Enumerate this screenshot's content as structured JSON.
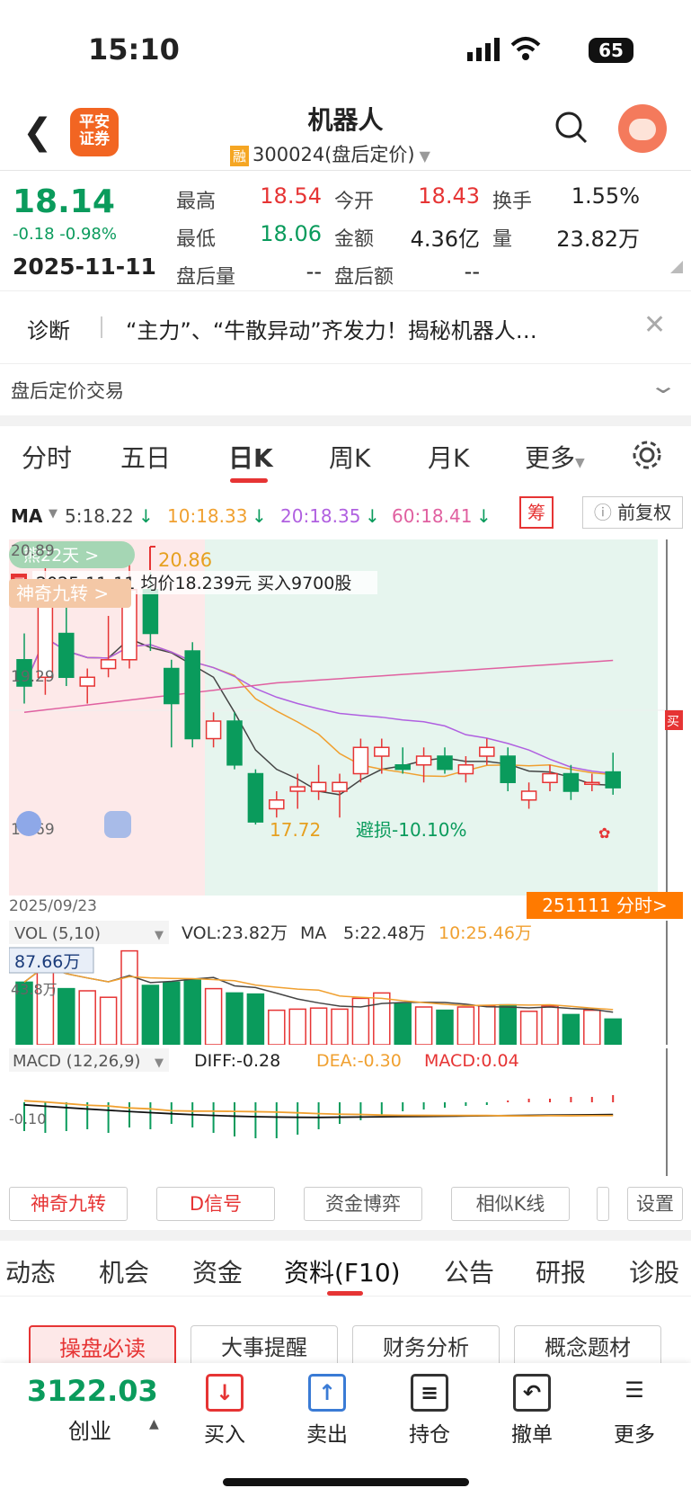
{
  "status": {
    "time": "15:10",
    "battery": "65"
  },
  "header": {
    "title": "机器人",
    "rong": "融",
    "subtitle": "300024(盘后定价)",
    "logo_l1": "平安",
    "logo_l2": "证券"
  },
  "quote": {
    "price": "18.14",
    "change": "-0.18 -0.98%",
    "date": "2025-11-11",
    "items": [
      {
        "label": "最高",
        "value": "18.54",
        "color": "red"
      },
      {
        "label": "今开",
        "value": "18.43",
        "color": "red"
      },
      {
        "label": "换手",
        "value": "1.55%",
        "color": "blk"
      },
      {
        "label": "最低",
        "value": "18.06",
        "color": "green"
      },
      {
        "label": "金额",
        "value": "4.36亿",
        "color": "blk"
      },
      {
        "label": "量",
        "value": "23.82万",
        "color": "blk"
      },
      {
        "label": "盘后量",
        "value": "--",
        "color": "blk"
      },
      {
        "label": "盘后额",
        "value": "--",
        "color": "blk"
      }
    ]
  },
  "diagnosis": {
    "label": "诊断",
    "text": "“主力”、“牛散异动”齐发力！揭秘机器人…"
  },
  "after_hours": {
    "label": "盘后定价交易"
  },
  "chart_tabs": [
    "分时",
    "五日",
    "日K",
    "周K",
    "月K",
    "更多"
  ],
  "ma_legend": {
    "title": "MA",
    "ma5": "5:18.22",
    "ma10": "10:18.33",
    "ma20": "20:18.35",
    "ma60": "60:18.41",
    "colors": {
      "ma5": "#444444",
      "ma10": "#f0a030",
      "ma20": "#b060e0",
      "ma60": "#e060a0"
    }
  },
  "chip_btn": "筹",
  "fq_btn": "前复权",
  "kchart": {
    "bear_label": "熊22天 >",
    "high_label": "20.86",
    "trade_info": "2025-11-11 均价18.239元 买入9700股",
    "shenqi_tag": "神奇九转 >",
    "y_top": "20.89",
    "y_mid": "19.29",
    "y_bot": "17.69",
    "low_label": "17.72",
    "stop_loss": "避损-10.10%",
    "buy_flag": "买",
    "trade_flag": "买"
  },
  "x_start": "2025/09/23",
  "fenshi_btn": "251111 分时>",
  "vol": {
    "title": "VOL (5,10)",
    "vol": "VOL:23.82万",
    "ma": "MA",
    "ma5": "5:22.48万",
    "ma10": "10:25.46万",
    "max_label": "87.66万",
    "mid_label": "43.8万"
  },
  "macd": {
    "title": "MACD (12,26,9)",
    "diff": "DIFF:-0.28",
    "dea": "DEA:-0.30",
    "macd": "MACD:0.04",
    "y_label": "-0.10"
  },
  "tools": [
    "神奇九转",
    "D信号",
    "资金博弈",
    "相似K线",
    "设置"
  ],
  "f_tabs": [
    "动态",
    "机会",
    "资金",
    "资料(F10)",
    "公告",
    "研报",
    "诊股"
  ],
  "sub_btns": [
    "操盘必读",
    "大事提醒",
    "财务分析",
    "概念题材"
  ],
  "bottom": {
    "index_value": "3122.03",
    "index_name": "创业",
    "actions": [
      {
        "label": "买入",
        "icon": "↓"
      },
      {
        "label": "卖出",
        "icon": "↑"
      },
      {
        "label": "持仓",
        "icon": "≡"
      },
      {
        "label": "撤单",
        "icon": "↶"
      },
      {
        "label": "更多",
        "icon": "☰"
      }
    ]
  },
  "chart_data": {
    "type": "candlestick",
    "x_start": "2025/09/23",
    "x_end": "2025-11-11",
    "ylim": [
      17.69,
      20.89
    ],
    "candles": [
      {
        "o": 19.6,
        "c": 19.3,
        "h": 19.9,
        "l": 19.1
      },
      {
        "o": 19.4,
        "c": 20.4,
        "h": 20.8,
        "l": 19.2
      },
      {
        "o": 19.9,
        "c": 19.4,
        "h": 20.2,
        "l": 19.3
      },
      {
        "o": 19.3,
        "c": 19.4,
        "h": 19.5,
        "l": 19.1
      },
      {
        "o": 19.5,
        "c": 19.6,
        "h": 20.1,
        "l": 19.4
      },
      {
        "o": 19.6,
        "c": 20.4,
        "h": 20.86,
        "l": 19.5
      },
      {
        "o": 20.4,
        "c": 19.9,
        "h": 20.6,
        "l": 19.7
      },
      {
        "o": 19.5,
        "c": 19.1,
        "h": 19.6,
        "l": 18.6
      },
      {
        "o": 19.7,
        "c": 18.7,
        "h": 19.8,
        "l": 18.6
      },
      {
        "o": 18.7,
        "c": 18.9,
        "h": 19.0,
        "l": 18.6
      },
      {
        "o": 18.9,
        "c": 18.4,
        "h": 19.0,
        "l": 18.35
      },
      {
        "o": 18.3,
        "c": 17.75,
        "h": 18.35,
        "l": 17.72
      },
      {
        "o": 17.9,
        "c": 18.0,
        "h": 18.1,
        "l": 17.8
      },
      {
        "o": 18.1,
        "c": 18.15,
        "h": 18.3,
        "l": 17.9
      },
      {
        "o": 18.1,
        "c": 18.2,
        "h": 18.4,
        "l": 18.0
      },
      {
        "o": 18.1,
        "c": 18.2,
        "h": 18.3,
        "l": 17.8
      },
      {
        "o": 18.3,
        "c": 18.6,
        "h": 18.7,
        "l": 18.2
      },
      {
        "o": 18.5,
        "c": 18.6,
        "h": 18.7,
        "l": 18.3
      },
      {
        "o": 18.4,
        "c": 18.35,
        "h": 18.6,
        "l": 18.3
      },
      {
        "o": 18.4,
        "c": 18.5,
        "h": 18.6,
        "l": 18.2
      },
      {
        "o": 18.5,
        "c": 18.35,
        "h": 18.6,
        "l": 18.3
      },
      {
        "o": 18.3,
        "c": 18.4,
        "h": 18.5,
        "l": 18.2
      },
      {
        "o": 18.5,
        "c": 18.6,
        "h": 18.7,
        "l": 18.4
      },
      {
        "o": 18.5,
        "c": 18.2,
        "h": 18.6,
        "l": 18.1
      },
      {
        "o": 18.0,
        "c": 18.1,
        "h": 18.2,
        "l": 17.9
      },
      {
        "o": 18.2,
        "c": 18.3,
        "h": 18.4,
        "l": 18.1
      },
      {
        "o": 18.3,
        "c": 18.1,
        "h": 18.4,
        "l": 18.0
      },
      {
        "o": 18.2,
        "c": 18.2,
        "h": 18.3,
        "l": 18.1
      },
      {
        "o": 18.32,
        "c": 18.14,
        "h": 18.54,
        "l": 18.06
      }
    ],
    "volumes_wan": [
      58,
      87.66,
      52,
      50,
      44,
      87,
      55,
      58,
      60,
      52,
      48,
      47,
      32,
      33,
      34,
      33,
      43,
      48,
      38,
      35,
      32,
      35,
      36,
      37,
      31,
      36,
      28,
      32,
      23.82
    ],
    "macd_hist": [
      -0.16,
      -0.17,
      -0.16,
      -0.15,
      -0.17,
      -0.14,
      -0.15,
      -0.12,
      -0.14,
      -0.17,
      -0.19,
      -0.2,
      -0.2,
      -0.18,
      -0.15,
      -0.12,
      -0.1,
      -0.07,
      -0.05,
      -0.04,
      -0.03,
      -0.02,
      -0.015,
      0.01,
      0.02,
      0.02,
      0.03,
      0.03,
      0.04
    ]
  }
}
